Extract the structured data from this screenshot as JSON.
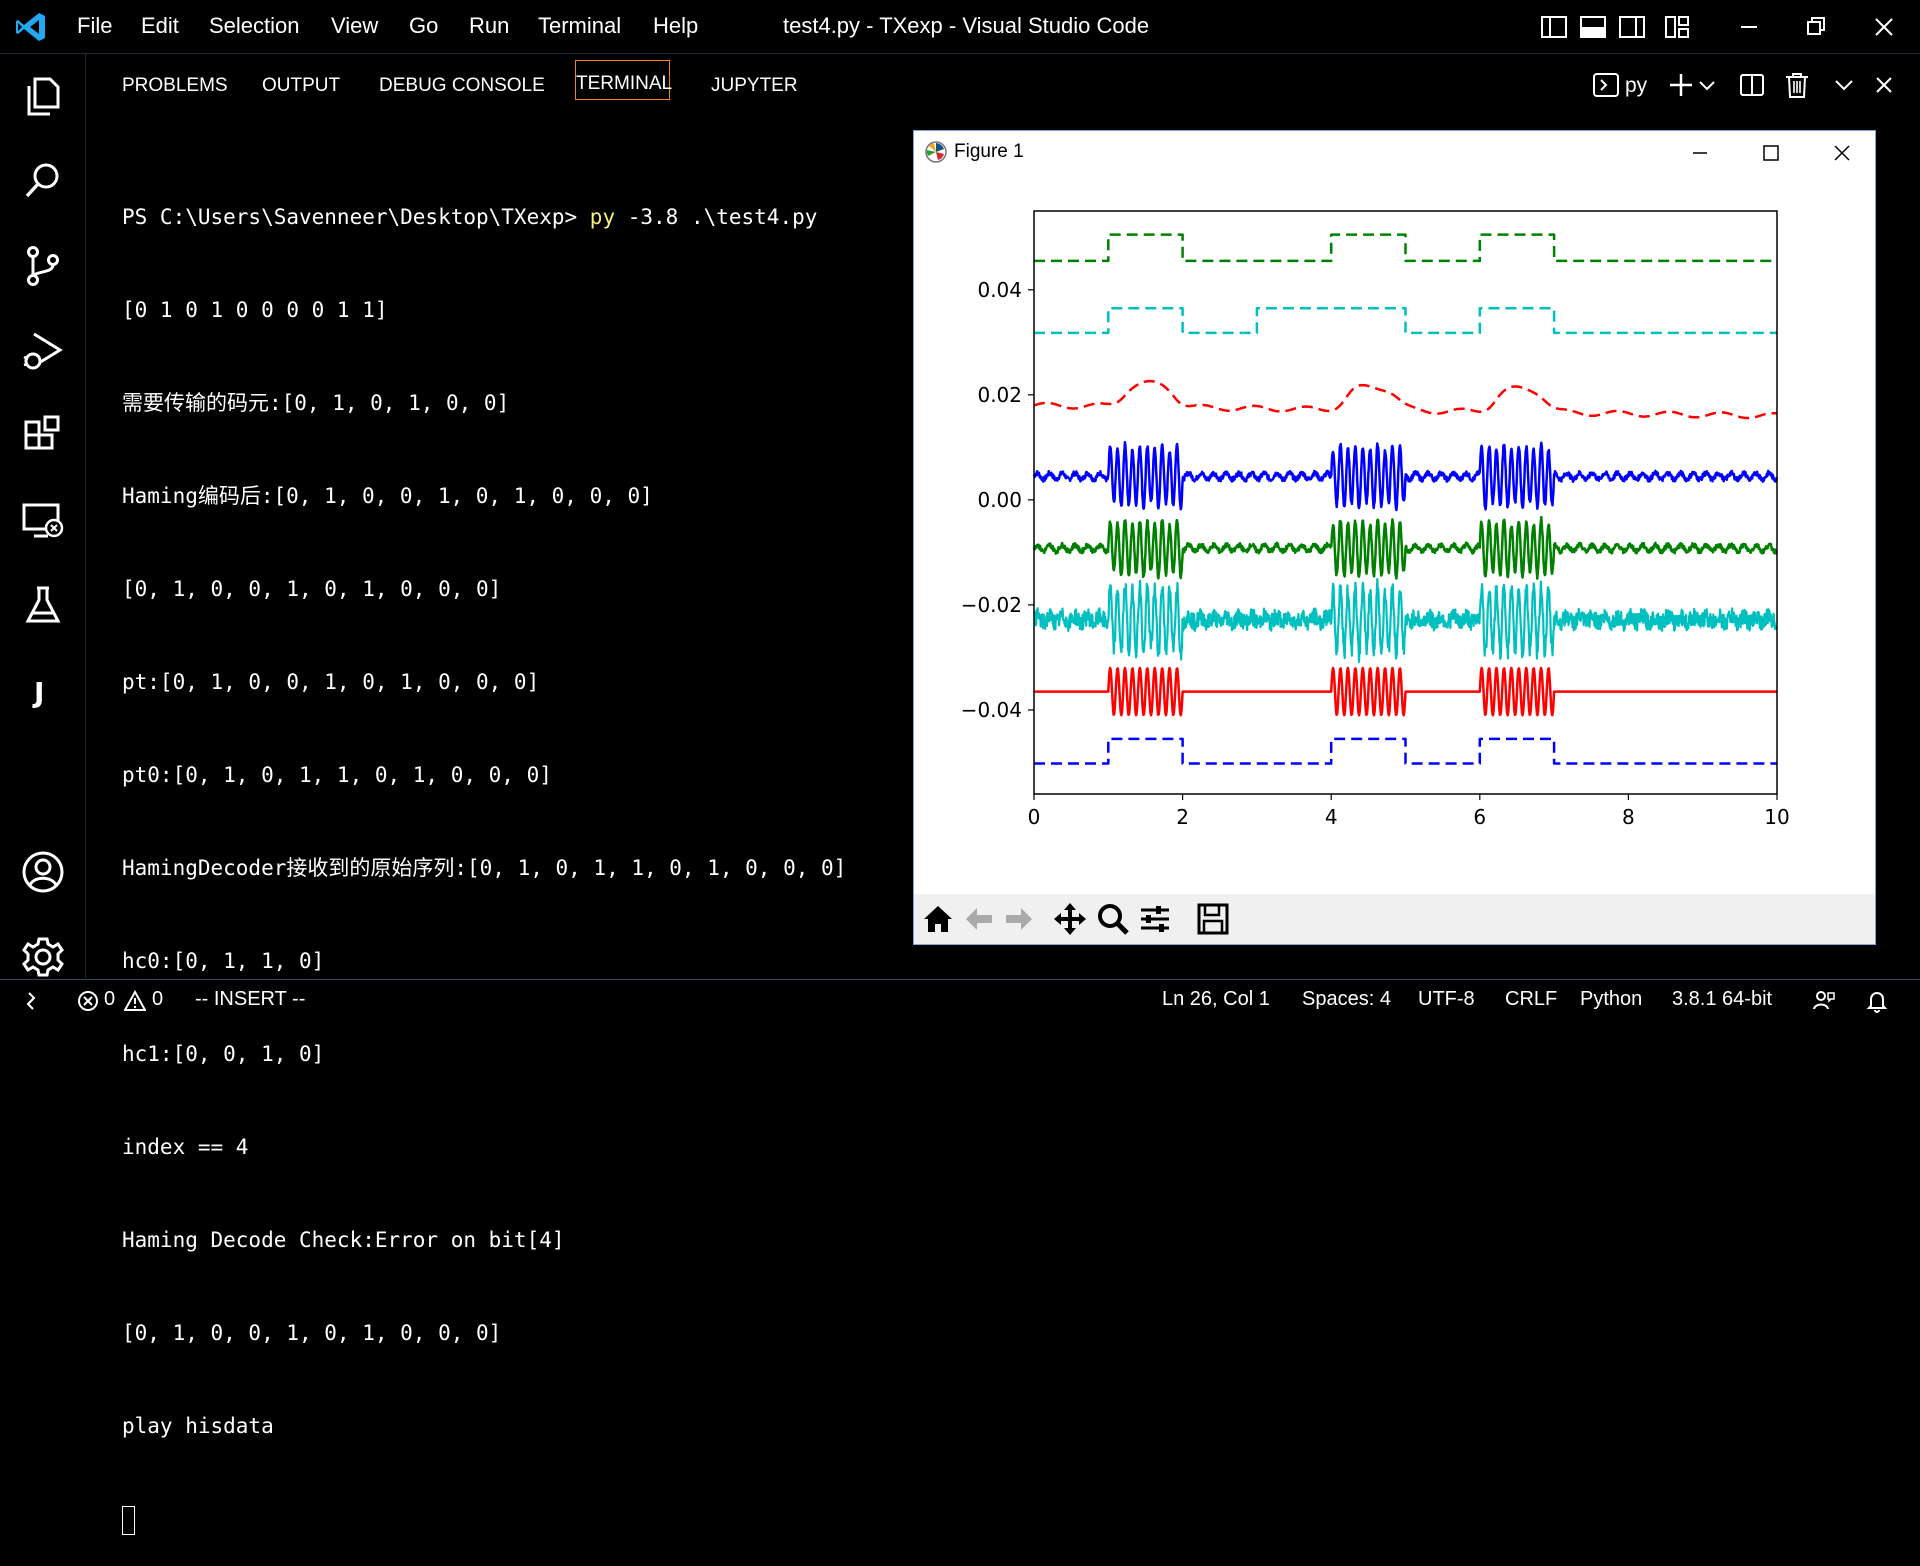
{
  "titlebar": {
    "menu": [
      "File",
      "Edit",
      "Selection",
      "View",
      "Go",
      "Run",
      "Terminal",
      "Help"
    ],
    "window_title": "test4.py - TXexp - Visual Studio Code"
  },
  "activitybar": {
    "icons": [
      "explorer-icon",
      "search-icon",
      "source-control-icon",
      "run-debug-icon",
      "extensions-icon",
      "remote-explorer-icon",
      "testing-icon",
      "jupyter-icon",
      "accounts-icon",
      "settings-icon"
    ]
  },
  "panel": {
    "tabs": [
      "PROBLEMS",
      "OUTPUT",
      "DEBUG CONSOLE",
      "TERMINAL",
      "JUPYTER"
    ],
    "active_tab": "TERMINAL",
    "terminal_name": "py"
  },
  "terminal": {
    "prompt": "PS C:\\Users\\Savenneer\\Desktop\\TXexp> ",
    "cmd_exe": "py",
    "cmd_args": " -3.8 .\\test4.py",
    "lines": [
      "[0 1 0 1 0 0 0 0 1 1]",
      "需要传输的码元:[0, 1, 0, 1, 0, 0]",
      "Haming编码后:[0, 1, 0, 0, 1, 0, 1, 0, 0, 0]",
      "[0, 1, 0, 0, 1, 0, 1, 0, 0, 0]",
      "pt:[0, 1, 0, 0, 1, 0, 1, 0, 0, 0]",
      "pt0:[0, 1, 0, 1, 1, 0, 1, 0, 0, 0]",
      "HamingDecoder接收到的原始序列:[0, 1, 0, 1, 1, 0, 1, 0, 0, 0]",
      "hc0:[0, 1, 1, 0]",
      "hc1:[0, 0, 1, 0]",
      "index == 4",
      "Haming Decode Check:Error on bit[4]",
      "[0, 1, 0, 0, 1, 0, 1, 0, 0, 0]",
      "play hisdata"
    ]
  },
  "figure": {
    "title": "Figure 1",
    "toolbar": [
      "home-icon",
      "back-icon",
      "forward-icon",
      "pan-icon",
      "zoom-icon",
      "configure-icon",
      "save-icon"
    ]
  },
  "chart_data": {
    "type": "line",
    "title": "",
    "xlabel": "",
    "ylabel": "",
    "xlim": [
      0,
      10
    ],
    "ylim": [
      -0.056,
      0.055
    ],
    "xticks": [
      0,
      2,
      4,
      6,
      8,
      10
    ],
    "xtick_labels": [
      "0",
      "2",
      "4",
      "6",
      "8",
      "10"
    ],
    "yticks": [
      -0.04,
      -0.02,
      0.0,
      0.02,
      0.04
    ],
    "ytick_labels": [
      "−0.04",
      "−0.02",
      "0.00",
      "0.02",
      "0.04"
    ],
    "grid": false,
    "high_intervals": [
      [
        1,
        2
      ],
      [
        4,
        5
      ],
      [
        6,
        7
      ]
    ],
    "series": [
      {
        "kind": "square",
        "style": "dashed",
        "color": "#008000",
        "base": 0.0455,
        "high": 0.0505,
        "intervals": [
          [
            1,
            2
          ],
          [
            4,
            5
          ],
          [
            6,
            7
          ]
        ]
      },
      {
        "kind": "square",
        "style": "dashed",
        "color": "#00bfbf",
        "base": 0.0318,
        "high": 0.0365,
        "intervals": [
          [
            1,
            2
          ],
          [
            3,
            5
          ],
          [
            6,
            7
          ]
        ]
      },
      {
        "kind": "smooth-square",
        "style": "dashed",
        "color": "#ff0000",
        "base": 0.018,
        "high": 0.0225,
        "intervals": [
          [
            1,
            2
          ],
          [
            4,
            5
          ],
          [
            6,
            7
          ]
        ]
      },
      {
        "kind": "noisy-ask",
        "style": "solid",
        "color": "#0000ff",
        "base": 0.0045,
        "amplitude": 0.0055,
        "intervals": [
          [
            1,
            2
          ],
          [
            4,
            5
          ],
          [
            6,
            7
          ]
        ]
      },
      {
        "kind": "noisy-ask",
        "style": "solid",
        "color": "#008000",
        "base": -0.0092,
        "amplitude": 0.005,
        "intervals": [
          [
            1,
            2
          ],
          [
            4,
            5
          ],
          [
            6,
            7
          ]
        ]
      },
      {
        "kind": "noisy-ask-heavy",
        "style": "solid",
        "color": "#00bfbf",
        "base": -0.0228,
        "amplitude": 0.006,
        "intervals": [
          [
            1,
            2
          ],
          [
            4,
            5
          ],
          [
            6,
            7
          ]
        ]
      },
      {
        "kind": "ask",
        "style": "solid",
        "color": "#ff0000",
        "base": -0.0365,
        "amplitude": 0.0045,
        "intervals": [
          [
            1,
            2
          ],
          [
            4,
            5
          ],
          [
            6,
            7
          ]
        ]
      },
      {
        "kind": "square",
        "style": "dashed",
        "color": "#0000ff",
        "base": -0.0502,
        "high": -0.0455,
        "intervals": [
          [
            1,
            2
          ],
          [
            4,
            5
          ],
          [
            6,
            7
          ]
        ]
      }
    ]
  },
  "statusbar": {
    "errors": "0",
    "warnings": "0",
    "mode": "-- INSERT --",
    "position": "Ln 26, Col 1",
    "spaces": "Spaces: 4",
    "encoding": "UTF-8",
    "eol": "CRLF",
    "language": "Python",
    "interpreter": "3.8.1 64-bit"
  }
}
